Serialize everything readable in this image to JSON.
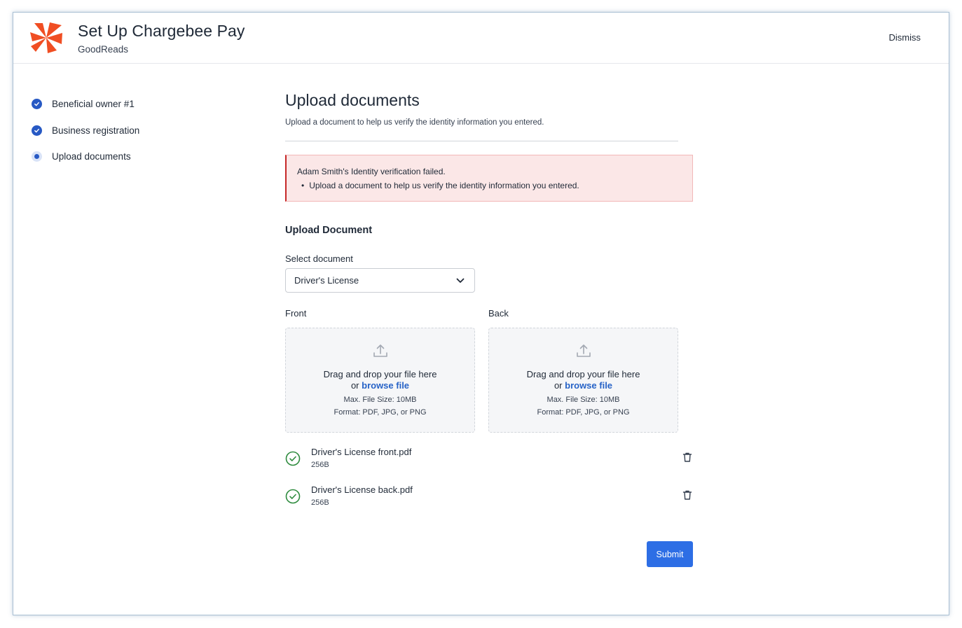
{
  "header": {
    "title": "Set Up Chargebee Pay",
    "subtitle": "GoodReads",
    "dismiss_label": "Dismiss",
    "logo_icon": "chargebee-logo-icon",
    "brand_color": "#f04e23"
  },
  "steps": [
    {
      "label": "Beneficial owner #1",
      "status": "done"
    },
    {
      "label": "Business registration",
      "status": "done"
    },
    {
      "label": "Upload documents",
      "status": "current"
    }
  ],
  "main": {
    "title": "Upload documents",
    "description": "Upload a document to help us verify the identity information you entered.",
    "alert": {
      "message": "Adam Smith's Identity verification failed.",
      "bullet": "Upload a document to help us verify the identity information you entered."
    },
    "section_title": "Upload Document",
    "select_label": "Select document",
    "select_value": "Driver's License",
    "front": {
      "label": "Front",
      "drop_text": "Drag and drop your file here",
      "or_text": "or",
      "browse_label": "browse file",
      "max_size": "Max. File Size: 10MB",
      "formats": "Format: PDF, JPG, or PNG"
    },
    "back": {
      "label": "Back",
      "drop_text": "Drag and drop your file here",
      "or_text": "or",
      "browse_label": "browse file",
      "max_size": "Max. File Size: 10MB",
      "formats": "Format: PDF, JPG, or PNG"
    },
    "files": [
      {
        "name": "Driver's License front.pdf",
        "size": "256B"
      },
      {
        "name": "Driver's License back.pdf",
        "size": "256B"
      }
    ],
    "submit_label": "Submit"
  },
  "colors": {
    "accent": "#2d6ee5",
    "step": "#2759c4",
    "alert_bg": "#fbe7e7",
    "alert_border": "#c62828",
    "success": "#2e8b3e"
  }
}
